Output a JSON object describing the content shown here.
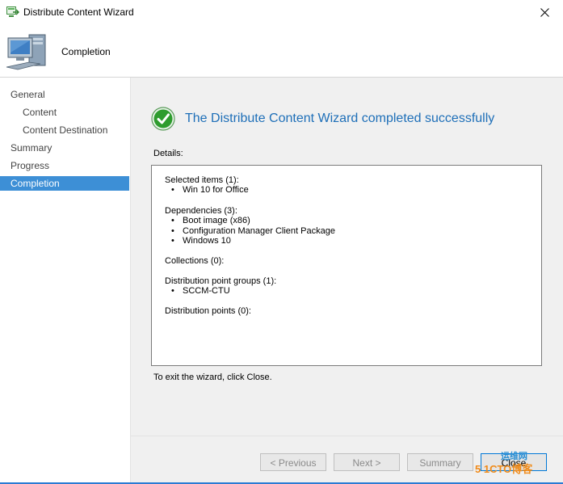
{
  "window": {
    "title": "Distribute Content Wizard"
  },
  "header": {
    "title": "Completion"
  },
  "sidebar": {
    "items": [
      {
        "label": "General",
        "indent": 0,
        "selected": false
      },
      {
        "label": "Content",
        "indent": 1,
        "selected": false
      },
      {
        "label": "Content Destination",
        "indent": 1,
        "selected": false
      },
      {
        "label": "Summary",
        "indent": 0,
        "selected": false
      },
      {
        "label": "Progress",
        "indent": 0,
        "selected": false
      },
      {
        "label": "Completion",
        "indent": 0,
        "selected": true
      }
    ]
  },
  "main": {
    "success_message": "The Distribute Content Wizard completed successfully",
    "details_label": "Details:",
    "details": [
      {
        "heading": "Selected items (1):",
        "items": [
          "Win 10 for Office"
        ]
      },
      {
        "heading": "Dependencies (3):",
        "items": [
          "Boot image (x86)",
          "Configuration Manager Client Package",
          "Windows 10"
        ]
      },
      {
        "heading": "Collections (0):",
        "items": []
      },
      {
        "heading": "Distribution point groups (1):",
        "items": [
          "SCCM-CTU"
        ]
      },
      {
        "heading": "Distribution points (0):",
        "items": []
      }
    ],
    "exit_text": "To exit the wizard, click Close."
  },
  "buttons": {
    "previous": "< Previous",
    "next": "Next >",
    "summary": "Summary",
    "close": "Close"
  },
  "watermark": {
    "top": "运维网",
    "main": "5 1CTO博客"
  },
  "colors": {
    "accent": "#3d8fd6",
    "success_text": "#1e6fb8",
    "success_icon": "#2e9c2e",
    "panel_bg": "#f0f0f0",
    "bottom_accent": "#2b7bd3"
  },
  "icons": {
    "app": "wizard-app-icon",
    "header": "computer-icon",
    "success": "checkmark-circle-icon",
    "close": "close-icon"
  }
}
